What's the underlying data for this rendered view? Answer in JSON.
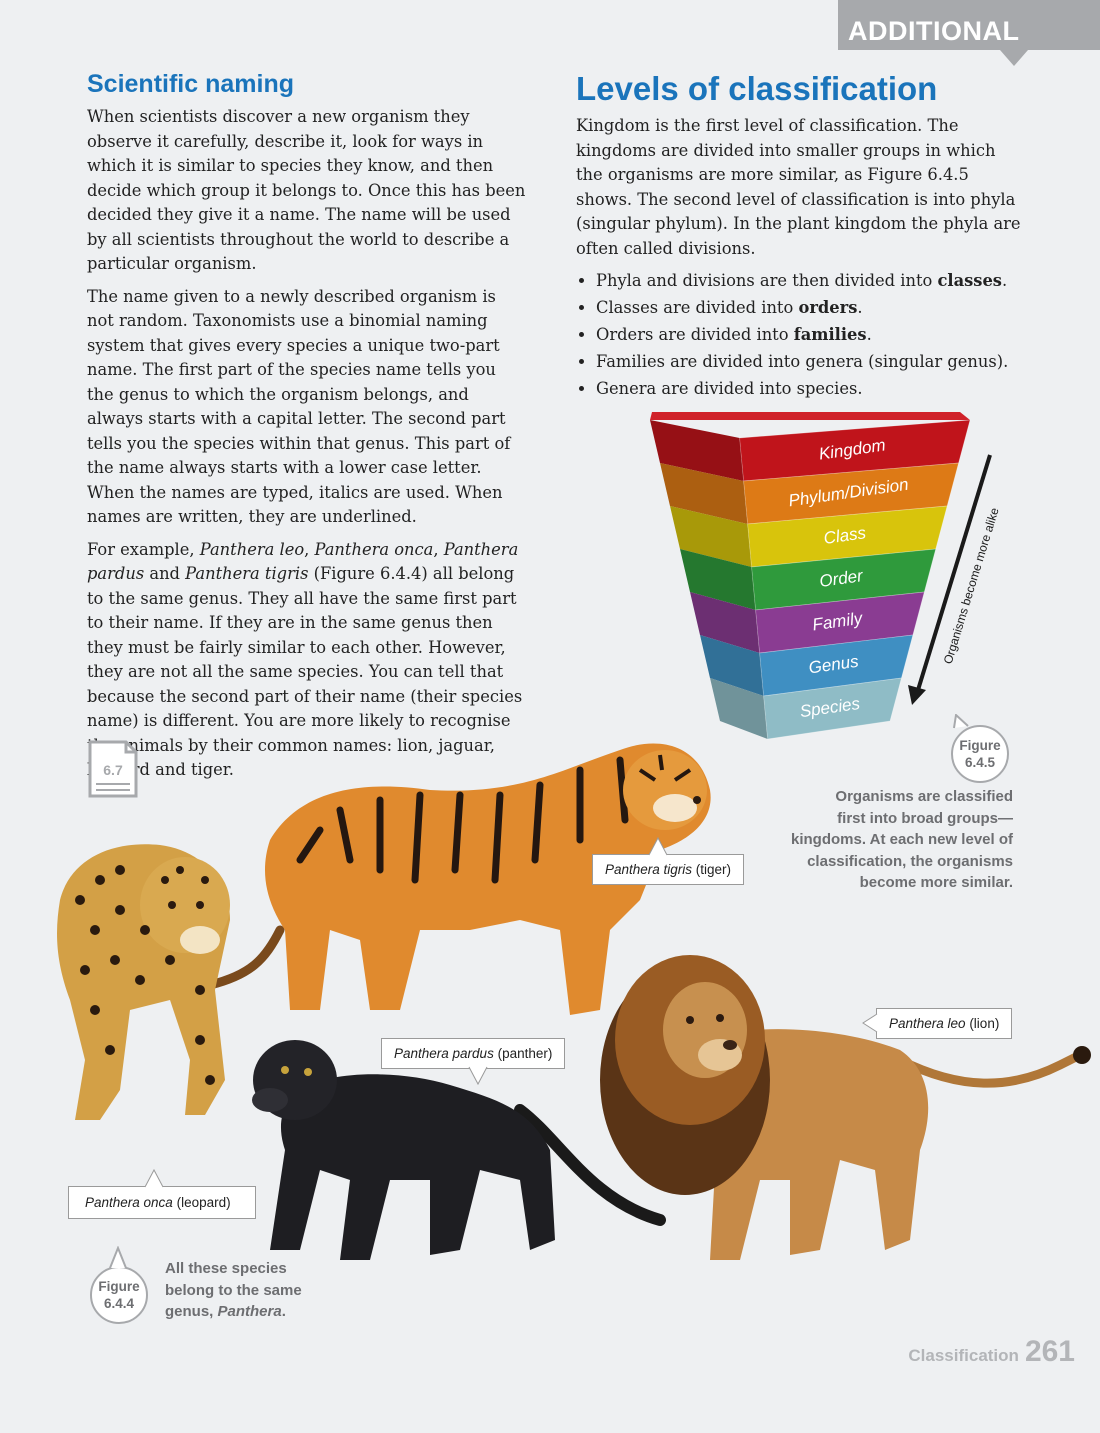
{
  "tab": {
    "label": "ADDITIONAL"
  },
  "left": {
    "heading": "Scientific naming",
    "para1": "When scientists discover a new organism they observe it carefully, describe it, look for ways in which it is similar to species they know, and then decide which group it belongs to. Once this has been decided they give it a name. The name will be used by all scientists throughout the world to describe a particular organism.",
    "para2": "The name given to a newly described organism is not random. Taxonomists use a binomial naming system that gives every species a unique two-part name. The first part of the species name tells you the genus to which the organism belongs, and always starts with a capital letter. The second part tells you the species within that genus. This part of the name always starts with a lower case letter. When the names are typed, italics are used. When names are written, they are underlined.",
    "para3": {
      "t1": "For example, ",
      "n1": "Panthera leo",
      "t2": ", ",
      "n2": "Panthera onca",
      "t3": ", ",
      "n3": "Panthera pardus",
      "t4": " and ",
      "n4": "Panthera tigris",
      "t5": " (Figure 6.4.4) all belong to the same genus. They all have the same first part to their name. If they are in the same genus then they must be fairly similar to each other. However, they are not all the same species. You can tell that because the second part of their name (their species name) is different. You are more likely to recognise the animals by their common names: lion, jaguar, leopard and tiger."
    },
    "doc_icon_label": "6.7"
  },
  "right": {
    "heading": "Levels of classification",
    "para": "Kingdom is the first level of classification. The kingdoms are divided into smaller groups in which the organisms are more similar, as Figure 6.4.5 shows. The second level of classification is into phyla (singular phylum). In the plant kingdom the phyla are often called divisions.",
    "bullets": [
      {
        "pre": "Phyla and divisions are then divided into ",
        "bold": "classes",
        "post": "."
      },
      {
        "pre": "Classes are divided into ",
        "bold": "orders",
        "post": "."
      },
      {
        "pre": "Orders are divided into ",
        "bold": "families",
        "post": "."
      },
      {
        "pre": "Families are divided into genera (singular genus).",
        "bold": "",
        "post": ""
      },
      {
        "pre": "Genera are divided into species.",
        "bold": "",
        "post": ""
      }
    ]
  },
  "pyramid": {
    "levels": [
      {
        "label": "Kingdom",
        "color": "#c0141b"
      },
      {
        "label": "Phylum/Division",
        "color": "#dd7a16"
      },
      {
        "label": "Class",
        "color": "#d8c40c"
      },
      {
        "label": "Order",
        "color": "#2f9a3c"
      },
      {
        "label": "Family",
        "color": "#8a3c92"
      },
      {
        "label": "Genus",
        "color": "#3f8fc2"
      },
      {
        "label": "Species",
        "color": "#8fbcc6"
      }
    ],
    "arrow_label": "Organisms become more alike"
  },
  "figure645": {
    "word": "Figure",
    "number": "6.4.5",
    "caption": [
      "Organisms are classified",
      "first into broad groups—",
      "kingdoms. At each new level of",
      "classification, the organisms",
      "become more similar."
    ]
  },
  "figure644": {
    "word": "Figure",
    "number": "6.4.4",
    "caption_line1": "All these species",
    "caption_line2": "belong to the same",
    "caption_line3_pre": "genus, ",
    "caption_line3_italic": "Panthera",
    "caption_line3_post": "."
  },
  "callouts": {
    "tiger": {
      "name": "Panthera tigris",
      "common": " (tiger)"
    },
    "lion": {
      "name": "Panthera leo",
      "common": " (lion)"
    },
    "panther": {
      "name": "Panthera pardus",
      "common": " (panther)"
    },
    "leopard": {
      "name": "Panthera onca",
      "common": " (leopard)"
    }
  },
  "footer": {
    "section": "Classification",
    "page": "261"
  }
}
